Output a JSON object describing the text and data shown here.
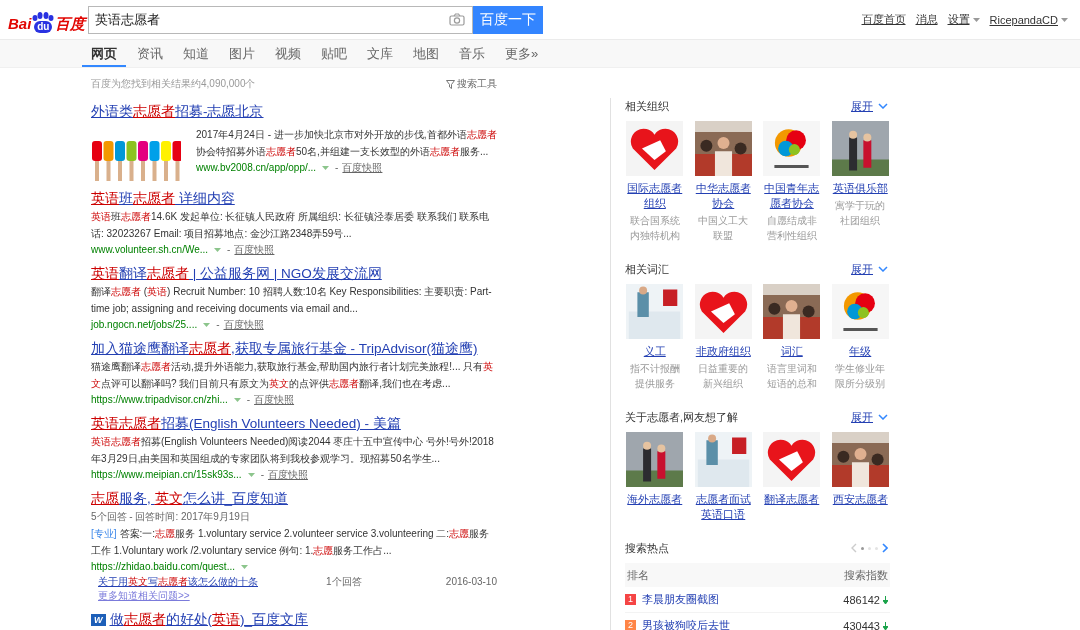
{
  "header": {
    "logo": {
      "left": "Bai",
      "paw": "du",
      "right": "百度"
    },
    "search": {
      "value": "英语志愿者"
    },
    "search_button": "百度一下",
    "links": [
      {
        "label": "百度首页",
        "dropdown": false
      },
      {
        "label": "消息",
        "dropdown": false
      },
      {
        "label": "设置",
        "dropdown": true
      },
      {
        "label": "RicepandaCD",
        "dropdown": true
      }
    ]
  },
  "tabs": [
    {
      "label": "网页",
      "selected": true
    },
    {
      "label": "资讯",
      "selected": false
    },
    {
      "label": "知道",
      "selected": false
    },
    {
      "label": "图片",
      "selected": false
    },
    {
      "label": "视频",
      "selected": false
    },
    {
      "label": "贴吧",
      "selected": false
    },
    {
      "label": "文库",
      "selected": false
    },
    {
      "label": "地图",
      "selected": false
    },
    {
      "label": "音乐",
      "selected": false
    },
    {
      "label": "更多»",
      "selected": false
    }
  ],
  "result_count": "百度为您找到相关结果约4,090,000个",
  "search_tools": "搜索工具",
  "results": [
    {
      "title": "外语类**志愿者**招募-志愿北京",
      "snippet": "2017年4月24日 - 进一步加快北京市对外开放的步伐,首都外语**志愿者**协会特招募外语**志愿者**50名,并组建一支长效型的外语**志愿者**服务...",
      "url": "www.bv2008.cn/app/opp/...",
      "snapshot": {
        "sep": "-",
        "label": "百度快照"
      }
    },
    {
      "kind": "plain",
      "title": "**英语**班**志愿者** 详细内容",
      "snippet": "**英语**班**志愿者**14.6K 发起单位: 长征镇人民政府 所属组织: 长征镇泾泰居委 联系我们 联系电话: 32023267 Email: 项目招募地点: 金沙江路2348弄59号...",
      "url": "www.volunteer.sh.cn/We...",
      "snapshot": {
        "sep": "-",
        "label": "百度快照"
      }
    },
    {
      "kind": "plain",
      "title": "**英语**翻译**志愿者** | 公益服务网 | NGO发展交流网",
      "snippet": "翻译**志愿者** (**英语**) Recruit Number: 10 招聘人数:10名 Key Responsibilities: 主要职责: Part-time job; assigning and receiving documents via email and...",
      "url": "job.ngocn.net/jobs/25....",
      "snapshot": {
        "sep": "-",
        "label": "百度快照"
      }
    },
    {
      "kind": "plain",
      "title": "加入猫途鹰翻译**志愿者**,获取专属旅行基金 - TripAdvisor(猫途鹰)",
      "snippet": "猫途鹰翻译**志愿者**活动,提升外语能力,获取旅行基金,帮助国内旅行者计划完美旅程!... 只有**英文**点评可以翻译吗? 我们目前只有原文为**英文**的点评供**志愿者**翻译,我们也在考虑...",
      "url": "https://www.tripadvisor.cn/zhi...",
      "snapshot": {
        "sep": "-",
        "label": "百度快照"
      }
    },
    {
      "kind": "plain",
      "title": "**英语志愿者**招募(English Volunteers Needed) - 美篇",
      "snippet": "**英语志愿者**招募(English Volunteers Needed)阅读2044 枣庄十五中宣传中心 号外!号外!2018年3月29日,由美国和英国组成的专家团队将到我校参观学习。现招募50名学生...",
      "url": "https://www.meipian.cn/15sk93s...",
      "snapshot": {
        "sep": "-",
        "label": "百度快照"
      }
    },
    {
      "kind": "zhidao",
      "title": "**志愿**服务, **英文**怎么讲_百度知道",
      "meta": "5个回答 - 回答时间: 2017年9月19日",
      "tag": "[专业]",
      "snippet": "答案:一:**志愿**服务 1.voluntary service 2.volunteer service 3.volunteering 二:**志愿**服务工作 1.Voluntary work /2.voluntary service 例句: 1.**志愿**服务工作占...",
      "url": "https://zhidao.baidu.com/quest...",
      "related": [
        {
          "title": "关于用**英文**写**志愿者**该怎么做的十条",
          "answers": "1个回答",
          "date": "2016-03-10"
        }
      ],
      "more": "更多知道相关问题>>"
    },
    {
      "kind": "wenku",
      "badge": "W",
      "title": "做**志愿者**的好处(**英语**)_百度文库"
    }
  ],
  "sidebar": {
    "sections": [
      {
        "title": "相关组织",
        "expand": "展开",
        "cards": [
          {
            "name": "国际志愿者组织",
            "desc": "联合国系统内独特机构"
          },
          {
            "name": "中华志愿者协会",
            "desc": "中国义工大联盟"
          },
          {
            "name": "中国青年志愿者协会",
            "desc": "自愿结成非营利性组织"
          },
          {
            "name": "英语俱乐部",
            "desc": "寓学于玩的社团组织"
          }
        ]
      },
      {
        "title": "相关词汇",
        "expand": "展开",
        "cards": [
          {
            "name": "义工",
            "desc": "指不计报酬提供服务"
          },
          {
            "name": "非政府组织",
            "desc": "日益重要的新兴组织"
          },
          {
            "name": "词汇",
            "desc": "语言里词和短语的总和"
          },
          {
            "name": "年级",
            "desc": "学生修业年限所分级别"
          }
        ]
      },
      {
        "title": "关于志愿者,网友想了解",
        "expand": "展开",
        "cards": [
          {
            "name": "海外志愿者"
          },
          {
            "name": "志愿者面试英语口语"
          },
          {
            "name": "翻译志愿者"
          },
          {
            "name": "西安志愿者"
          }
        ]
      }
    ],
    "hot": {
      "title": "搜索热点",
      "pages": [
        {
          "selected": true
        },
        {
          "selected": false
        },
        {
          "selected": false
        }
      ],
      "columns": [
        "排名",
        "搜索指数"
      ],
      "rows": [
        {
          "rank": "1",
          "color": "#f54545",
          "title": "李晨朋友圈截图",
          "count": "486142",
          "down": true
        },
        {
          "rank": "2",
          "color": "#ff8547",
          "title": "男孩被狗咬后去世",
          "count": "430443",
          "down": true
        }
      ]
    }
  }
}
